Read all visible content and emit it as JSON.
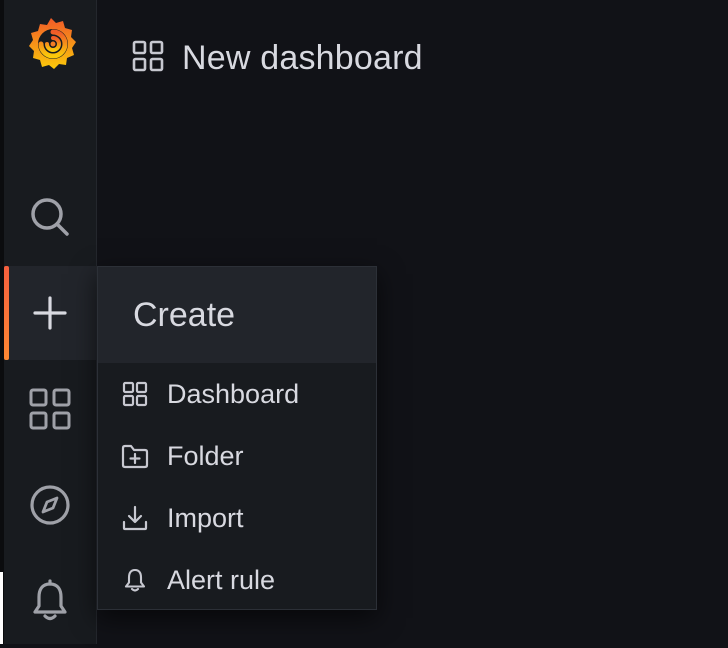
{
  "header": {
    "title": "New dashboard",
    "title_icon": "apps-icon"
  },
  "sidebar": {
    "logo": "grafana-logo",
    "items": [
      {
        "name": "search",
        "icon": "search-icon",
        "active": false
      },
      {
        "name": "create",
        "icon": "plus-icon",
        "active": true
      },
      {
        "name": "dashboards",
        "icon": "apps-icon",
        "active": false
      },
      {
        "name": "explore",
        "icon": "compass-icon",
        "active": false
      },
      {
        "name": "alerting",
        "icon": "bell-icon",
        "active": false
      }
    ]
  },
  "create_menu": {
    "title": "Create",
    "items": [
      {
        "label": "Dashboard",
        "icon": "apps-icon"
      },
      {
        "label": "Folder",
        "icon": "folder-plus-icon"
      },
      {
        "label": "Import",
        "icon": "import-icon"
      },
      {
        "label": "Alert rule",
        "icon": "bell-icon"
      }
    ]
  },
  "colors": {
    "background": "#111217",
    "sidebar": "#181b1f",
    "accent_start": "#f55f3e",
    "accent_end": "#ff8833",
    "text": "#d8d9e0",
    "icon": "#9fa1a8"
  }
}
